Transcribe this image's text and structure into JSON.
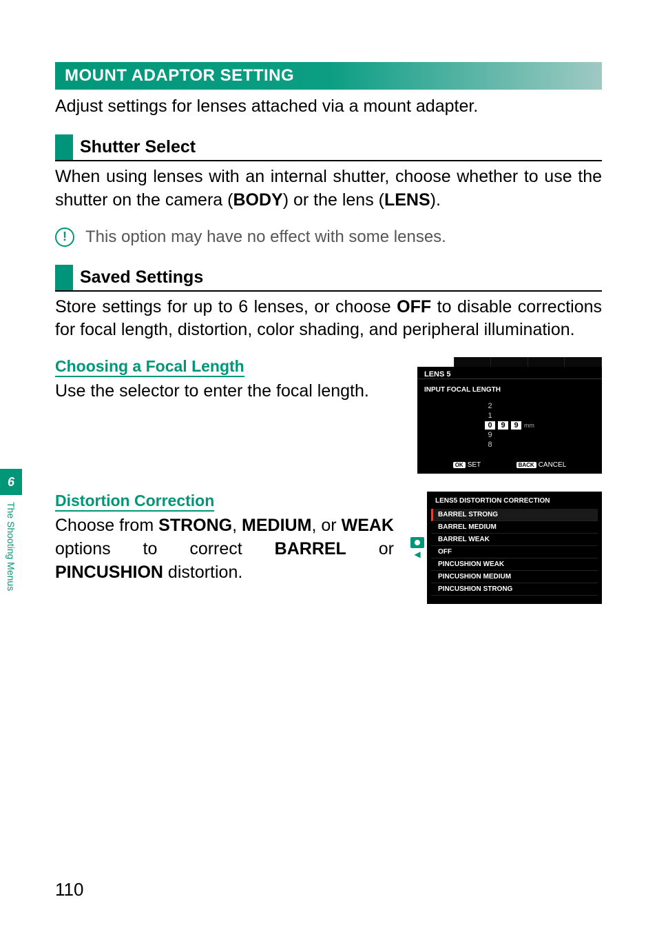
{
  "side_tab": {
    "chapter_num": "6",
    "chapter_label": "The Shooting Menus"
  },
  "page_number": "110",
  "section": {
    "title": "MOUNT ADAPTOR SETTING",
    "intro": "Adjust settings for lenses attached via a mount adapter."
  },
  "sub_shutter": {
    "heading": "Shutter Select",
    "body_prefix": "When using lenses with an internal shutter, choose whether to use the shutter on the camera (",
    "body_bold1": "BODY",
    "body_mid": ") or the lens (",
    "body_bold2": "LENS",
    "body_suffix": ")."
  },
  "note": {
    "icon_glyph": "!",
    "text": "This option may have no effect with some lenses."
  },
  "sub_saved": {
    "heading": "Saved Settings",
    "body_prefix": "Store settings for up to 6 lenses, or choose ",
    "body_bold": "OFF",
    "body_suffix": " to disable corrections for focal length, distortion, color shading, and peripheral illumination."
  },
  "focal": {
    "title": "Choosing a Focal Length",
    "body": "Use the selector to enter the focal length.",
    "lcd": {
      "title": "LENS 5",
      "subtitle": "INPUT FOCAL LENGTH",
      "col0_above2": "2",
      "col0_above1": "1",
      "col0_sel": "0",
      "col0_below1": "9",
      "col0_below2": "8",
      "col1_sel": "9",
      "col2_sel": "9",
      "unit": "mm",
      "ok_chip": "OK",
      "ok_label": "SET",
      "back_chip": "BACK",
      "back_label": "CANCEL"
    }
  },
  "distortion": {
    "title": "Distortion Correction",
    "body_p1": "Choose from ",
    "b1": "STRONG",
    "sep1": ", ",
    "b2": "MEDIUM",
    "sep2": ", or ",
    "b3": "WEAK",
    "mid": " options to correct ",
    "b4": "BARREL",
    "sep3": " or ",
    "b5": "PINCUSHION",
    "suffix": " distortion.",
    "lcd": {
      "title": "LENS5 DISTORTION CORRECTION",
      "items": {
        "i0": "BARREL STRONG",
        "i1": "BARREL MEDIUM",
        "i2": "BARREL WEAK",
        "i3": "OFF",
        "i4": "PINCUSHION WEAK",
        "i5": "PINCUSHION MEDIUM",
        "i6": "PINCUSHION STRONG"
      }
    }
  }
}
